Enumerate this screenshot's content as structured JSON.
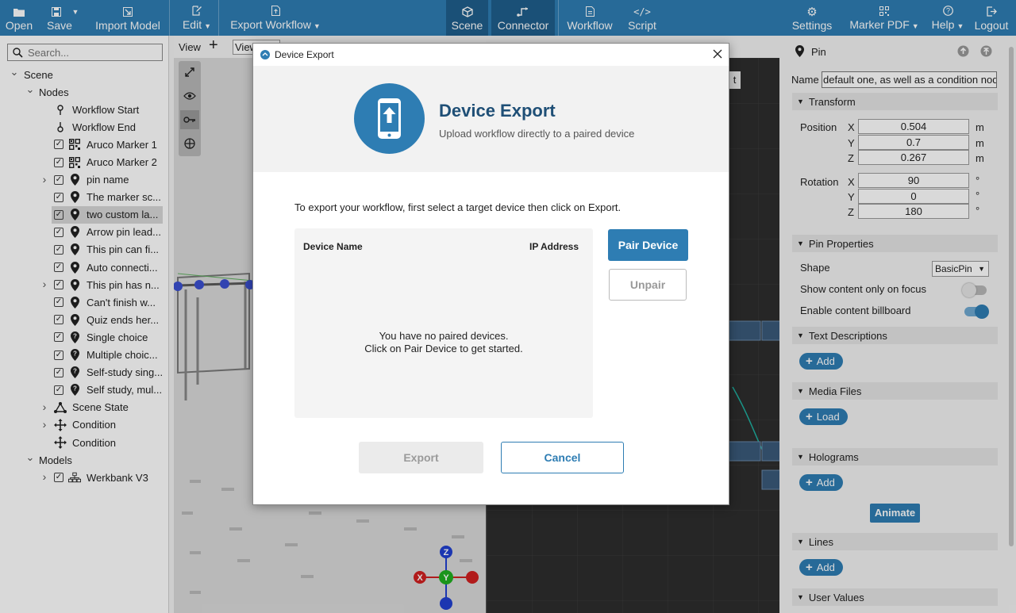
{
  "toolbar": {
    "open": "Open",
    "save": "Save",
    "import_model": "Import Model",
    "edit": "Edit",
    "export_workflow": "Export Workflow",
    "scene": "Scene",
    "connector": "Connector",
    "workflow": "Workflow",
    "script": "Script",
    "settings": "Settings",
    "marker_pdf": "Marker PDF",
    "help": "Help",
    "logout": "Logout"
  },
  "sidebar": {
    "search_placeholder": "Search...",
    "tree": [
      {
        "label": "Scene",
        "level": 0,
        "expand": "v",
        "check": false,
        "icon": ""
      },
      {
        "label": "Nodes",
        "level": 1,
        "expand": "v",
        "check": false,
        "icon": ""
      },
      {
        "label": "Workflow Start",
        "level": 2,
        "expand": "",
        "check": false,
        "icon": "start-pin"
      },
      {
        "label": "Workflow End",
        "level": 2,
        "expand": "",
        "check": false,
        "icon": "end-pin"
      },
      {
        "label": "Aruco Marker 1",
        "level": 2,
        "expand": "",
        "check": true,
        "icon": "qr"
      },
      {
        "label": "Aruco Marker 2",
        "level": 2,
        "expand": "",
        "check": true,
        "icon": "qr"
      },
      {
        "label": "pin name",
        "level": 2,
        "expand": ">",
        "check": true,
        "icon": "pin"
      },
      {
        "label": "The marker sc...",
        "level": 2,
        "expand": "",
        "check": true,
        "icon": "pin"
      },
      {
        "label": "two custom la...",
        "level": 2,
        "expand": "",
        "check": true,
        "icon": "pin",
        "selected": true
      },
      {
        "label": "Arrow pin lead...",
        "level": 2,
        "expand": "",
        "check": true,
        "icon": "pin"
      },
      {
        "label": "This pin can fi...",
        "level": 2,
        "expand": "",
        "check": true,
        "icon": "pin"
      },
      {
        "label": "Auto connecti...",
        "level": 2,
        "expand": "",
        "check": true,
        "icon": "pin"
      },
      {
        "label": "This pin has n...",
        "level": 2,
        "expand": ">",
        "check": true,
        "icon": "pin"
      },
      {
        "label": "Can't finish  w...",
        "level": 2,
        "expand": "",
        "check": true,
        "icon": "pin"
      },
      {
        "label": "Quiz ends her...",
        "level": 2,
        "expand": "",
        "check": true,
        "icon": "pin"
      },
      {
        "label": "Single choice",
        "level": 2,
        "expand": "",
        "check": true,
        "icon": "qpin"
      },
      {
        "label": "Multiple choic...",
        "level": 2,
        "expand": "",
        "check": true,
        "icon": "qpin"
      },
      {
        "label": "Self-study sing...",
        "level": 2,
        "expand": "",
        "check": true,
        "icon": "qpin"
      },
      {
        "label": "Self study, mul...",
        "level": 2,
        "expand": "",
        "check": true,
        "icon": "qpin"
      },
      {
        "label": "Scene State",
        "level": 2,
        "expand": ">",
        "check": false,
        "icon": "state"
      },
      {
        "label": "Condition",
        "level": 2,
        "expand": ">",
        "check": false,
        "icon": "condition"
      },
      {
        "label": "Condition",
        "level": 2,
        "expand": "",
        "check": false,
        "icon": "condition"
      },
      {
        "label": "Models",
        "level": 1,
        "expand": "v",
        "check": false,
        "icon": ""
      },
      {
        "label": "Werkbank V3",
        "level": 2,
        "expand": ">",
        "check": true,
        "icon": "model"
      }
    ]
  },
  "viewport": {
    "view_label": "View",
    "view_select": "View"
  },
  "graph": {
    "button_fragment": "t"
  },
  "properties": {
    "header": "Pin",
    "name_label": "Name",
    "name_value": "default one, as well as a condition node",
    "transform": "Transform",
    "position_label": "Position",
    "rotation_label": "Rotation",
    "axes": [
      "X",
      "Y",
      "Z"
    ],
    "position": [
      "0.504",
      "0.7",
      "0.267"
    ],
    "rotation": [
      "90",
      "0",
      "180"
    ],
    "unit_m": "m",
    "unit_deg": "°",
    "pin_properties": "Pin Properties",
    "shape_label": "Shape",
    "shape_value": "BasicPin",
    "show_focus_label": "Show content only on focus",
    "billboard_label": "Enable content billboard",
    "text_descriptions": "Text Descriptions",
    "add": "Add",
    "media_files": "Media Files",
    "load": "Load",
    "holograms": "Holograms",
    "animate": "Animate",
    "lines": "Lines",
    "user_values": "User Values",
    "accent": "#2e7db3"
  },
  "dialog": {
    "title": "Device Export",
    "heading": "Device Export",
    "subheading": "Upload workflow directly to a paired device",
    "instruction": "To export your workflow, first select a target device then click on Export.",
    "col_name": "Device Name",
    "col_ip": "IP Address",
    "empty_line1": "You have no paired devices.",
    "empty_line2": "Click on Pair Device to get started.",
    "pair": "Pair Device",
    "unpair": "Unpair",
    "export": "Export",
    "cancel": "Cancel"
  }
}
